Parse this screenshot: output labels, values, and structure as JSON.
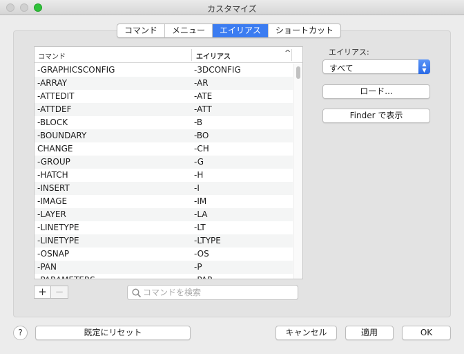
{
  "window": {
    "title": "カスタマイズ"
  },
  "tabs": [
    {
      "label": "コマンド"
    },
    {
      "label": "メニュー"
    },
    {
      "label": "エイリアス",
      "selected": true
    },
    {
      "label": "ショートカット"
    }
  ],
  "table": {
    "columns": {
      "command": "コマンド",
      "alias": "エイリアス",
      "sort": "^"
    },
    "rows": [
      {
        "command": "-GRAPHICSCONFIG",
        "alias": "-3DCONFIG"
      },
      {
        "command": "-ARRAY",
        "alias": "-AR"
      },
      {
        "command": "-ATTEDIT",
        "alias": "-ATE"
      },
      {
        "command": "-ATTDEF",
        "alias": "-ATT"
      },
      {
        "command": "-BLOCK",
        "alias": "-B"
      },
      {
        "command": "-BOUNDARY",
        "alias": "-BO"
      },
      {
        "command": "CHANGE",
        "alias": "-CH"
      },
      {
        "command": "-GROUP",
        "alias": "-G"
      },
      {
        "command": "-HATCH",
        "alias": "-H"
      },
      {
        "command": "-INSERT",
        "alias": "-I"
      },
      {
        "command": "-IMAGE",
        "alias": "-IM"
      },
      {
        "command": "-LAYER",
        "alias": "-LA"
      },
      {
        "command": "-LINETYPE",
        "alias": "-LT"
      },
      {
        "command": "-LINETYPE",
        "alias": "-LTYPE"
      },
      {
        "command": "-OSNAP",
        "alias": "-OS"
      },
      {
        "command": "-PAN",
        "alias": "-P"
      },
      {
        "command": "-PARAMETERS",
        "alias": "-PAR"
      }
    ]
  },
  "controls": {
    "add": "+",
    "remove": "−",
    "search_placeholder": "コマンドを検索"
  },
  "alias_panel": {
    "label": "エイリアス:",
    "filter_value": "すべて",
    "load_button": "ロード...",
    "finder_button": "Finder で表示"
  },
  "footer": {
    "help": "?",
    "reset": "既定にリセット",
    "cancel": "キャンセル",
    "apply": "適用",
    "ok": "OK"
  },
  "colors": {
    "accent": "#3b7cf1",
    "maximize": "#2fc23a"
  }
}
